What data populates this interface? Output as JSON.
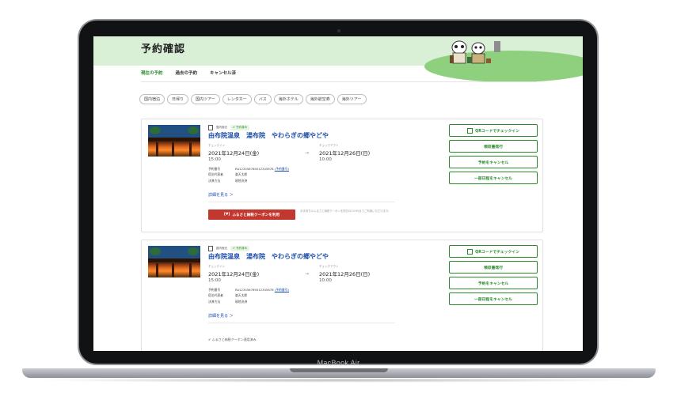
{
  "device": {
    "brand": "MacBook Air"
  },
  "page": {
    "title": "予約確認"
  },
  "tabs": [
    {
      "label": "現在の予約",
      "active": true
    },
    {
      "label": "過去の予約",
      "active": false
    },
    {
      "label": "キャンセル済",
      "active": false
    }
  ],
  "filters": [
    "国内宿泊",
    "日帰り",
    "国内ツアー",
    "レンタカー",
    "バス",
    "海外ホテル",
    "海外航空券",
    "海外ツアー"
  ],
  "reservations": [
    {
      "category": "国内宿泊",
      "status": "予約済み",
      "hotel": "由布院温泉　湯布院　やわらぎの郷やどや",
      "checkin_label": "チェックイン",
      "checkin_date": "2021年12月24日(金)",
      "checkin_time": "15:00",
      "checkout_label": "チェックアウト",
      "checkout_date": "2021年12月26日(日)",
      "checkout_time": "10:00",
      "reservation_no_label": "予約番号",
      "reservation_no": "RA123456789012345678",
      "change_link": "(予約番号)",
      "rep_label": "宿泊代表者",
      "rep_value": "楽天太郎",
      "payment_label": "決済方法",
      "payment_value": "現地決済",
      "details_link": "詳細を見る ＞",
      "coupon_button": "ふるさと納税クーポンを利用",
      "coupon_note": "お手持ちのふるさと納税クーポンを前日の23:59までご利用いただけます。",
      "actions": [
        "QRコードでチェックイン",
        "領収書発行",
        "予約をキャンセル",
        "一部日程をキャンセル"
      ]
    },
    {
      "category": "国内宿泊",
      "status": "予約済み",
      "hotel": "由布院温泉　湯布院　やわらぎの郷やどや",
      "checkin_label": "チェックイン",
      "checkin_date": "2021年12月24日(金)",
      "checkin_time": "15:00",
      "checkout_label": "チェックアウト",
      "checkout_date": "2021年12月26日(日)",
      "checkout_time": "10:00",
      "reservation_no_label": "予約番号",
      "reservation_no": "RA123456789012345678",
      "change_link": "(予約番号)",
      "rep_label": "宿泊代表者",
      "rep_value": "楽天太郎",
      "payment_label": "決済方法",
      "payment_value": "現地決済",
      "details_link": "詳細を見る ＞",
      "coupon_applied": "✔ ふるさと納税クーポン適用済み",
      "actions": [
        "QRコードでチェックイン",
        "領収書発行",
        "予約をキャンセル",
        "一部日程をキャンセル"
      ]
    }
  ],
  "colors": {
    "accent_green": "#2a8a2a",
    "link_blue": "#1e4ea8",
    "coupon_red": "#c2382e",
    "header_bg": "#d9efd6"
  },
  "icons": {
    "qr": "qr-code-icon",
    "document": "document-icon",
    "check": "check-icon"
  }
}
